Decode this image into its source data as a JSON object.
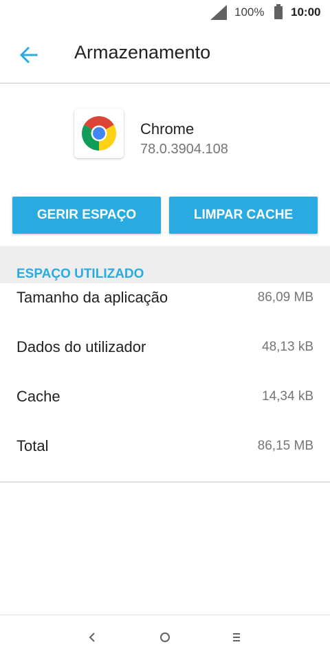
{
  "status_bar": {
    "battery_percent": "100%",
    "time": "10:00"
  },
  "app_bar": {
    "title": "Armazenamento",
    "back_icon": "arrow-back-icon"
  },
  "app_info": {
    "name": "Chrome",
    "version": "78.0.3904.108",
    "icon": "chrome-logo-icon"
  },
  "actions": {
    "manage_label": "GERIR ESPAÇO",
    "clear_cache_label": "LIMPAR CACHE",
    "accent_color": "#29abe2"
  },
  "storage": {
    "section_title": "ESPAÇO UTILIZADO",
    "rows": [
      {
        "label": "Tamanho da aplicação",
        "value": "86,09 MB"
      },
      {
        "label": "Dados do utilizador",
        "value": "48,13 kB"
      },
      {
        "label": "Cache",
        "value": "14,34 kB"
      },
      {
        "label": "Total",
        "value": "86,15 MB"
      }
    ]
  },
  "nav_bar": {
    "back_icon": "nav-back-icon",
    "home_icon": "nav-home-icon",
    "recent_icon": "nav-menu-icon"
  }
}
